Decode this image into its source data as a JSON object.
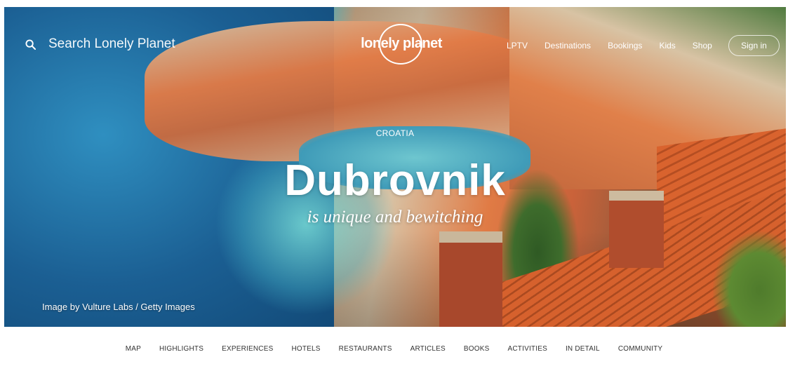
{
  "header": {
    "search_placeholder": "Search Lonely Planet",
    "logo_text": "lonely planet",
    "nav": [
      "LPTV",
      "Destinations",
      "Bookings",
      "Kids",
      "Shop"
    ],
    "signin_label": "Sign in"
  },
  "hero": {
    "country": "CROATIA",
    "title": "Dubrovnik",
    "subtitle": "is unique and bewitching",
    "credit": "Image by Vulture Labs / Getty Images"
  },
  "subnav": [
    "MAP",
    "HIGHLIGHTS",
    "EXPERIENCES",
    "HOTELS",
    "RESTAURANTS",
    "ARTICLES",
    "BOOKS",
    "ACTIVITIES",
    "IN DETAIL",
    "COMMUNITY"
  ],
  "icons": {
    "search": "search-icon",
    "logo": "lonely-planet-logo"
  }
}
